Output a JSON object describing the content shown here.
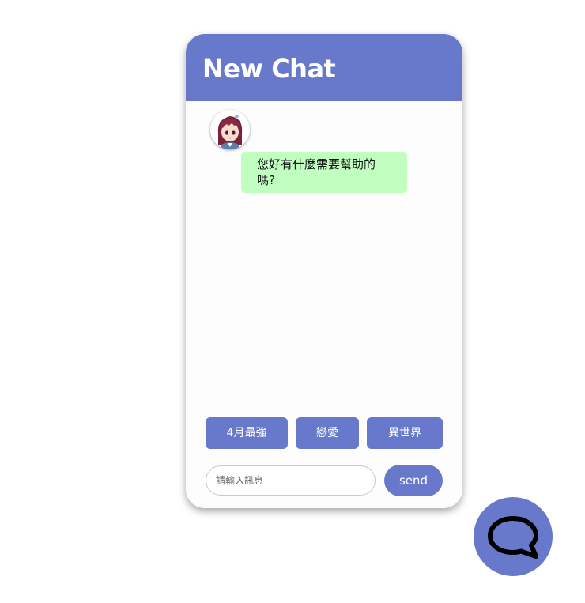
{
  "chat": {
    "title": "New Chat",
    "messages": [
      {
        "sender": "bot",
        "text": "您好有什麼需要幫助的嗎?"
      }
    ]
  },
  "quick_replies": [
    "4月最強",
    "戀愛",
    "異世界"
  ],
  "input": {
    "placeholder": "請輸入訊息",
    "value": ""
  },
  "send_label": "send",
  "colors": {
    "accent": "#6879cc",
    "bot_bubble": "#c1ffc1",
    "panel_bg": "#fdfdfd"
  },
  "icons": {
    "fab": "chat-bubble-icon",
    "avatar": "bot-avatar"
  }
}
